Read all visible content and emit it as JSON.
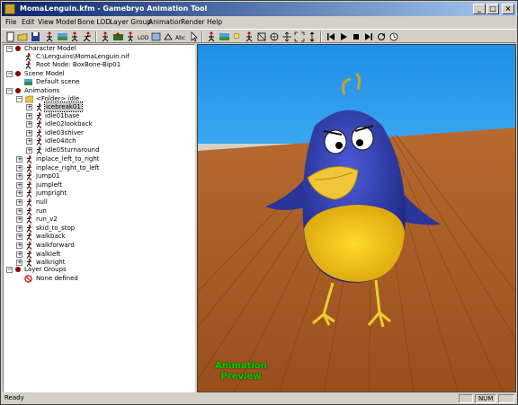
{
  "window": {
    "title": "MomaLenguin.kfm - Gamebryo Animation Tool"
  },
  "menu": [
    "File",
    "Edit",
    "View",
    "Model",
    "Bone LOD",
    "Layer Group",
    "Animation",
    "Render",
    "Help"
  ],
  "tree": {
    "character_model": "Character Model",
    "nif_path": "C:\\Lenguins\\MomaLenguin.nif",
    "root_node": "Root Node: BoxBone-Bip01",
    "scene_model": "Scene Model",
    "default_scene": "Default scene",
    "animations": "Animations",
    "folder_idle": "<Folder> idle",
    "folder_items": [
      "icebreak01",
      "idle01base",
      "idle02lookback",
      "idle03shiver",
      "idle04itch",
      "idle05turnaround"
    ],
    "anim_items": [
      "inplace_left_to_right",
      "inplace_right_to_left",
      "jump01",
      "jumpleft",
      "jumpright",
      "null",
      "run",
      "run_v2",
      "skid_to_stop",
      "walkback",
      "walkforward",
      "walkleft",
      "walkright"
    ],
    "layer_groups": "Layer Groups",
    "none_defined": "None defined"
  },
  "viewport": {
    "overlay_line1": "Animation",
    "overlay_line2": "Preview"
  },
  "status": {
    "text": "Ready",
    "num": "NUM"
  },
  "colors": {
    "title_start": "#0a246a",
    "title_end": "#a6caf0",
    "selection": "#c8c8c8",
    "overlay_text": "#00cc00",
    "sky": "#1f8fe6",
    "floor": "#c46a2a"
  }
}
